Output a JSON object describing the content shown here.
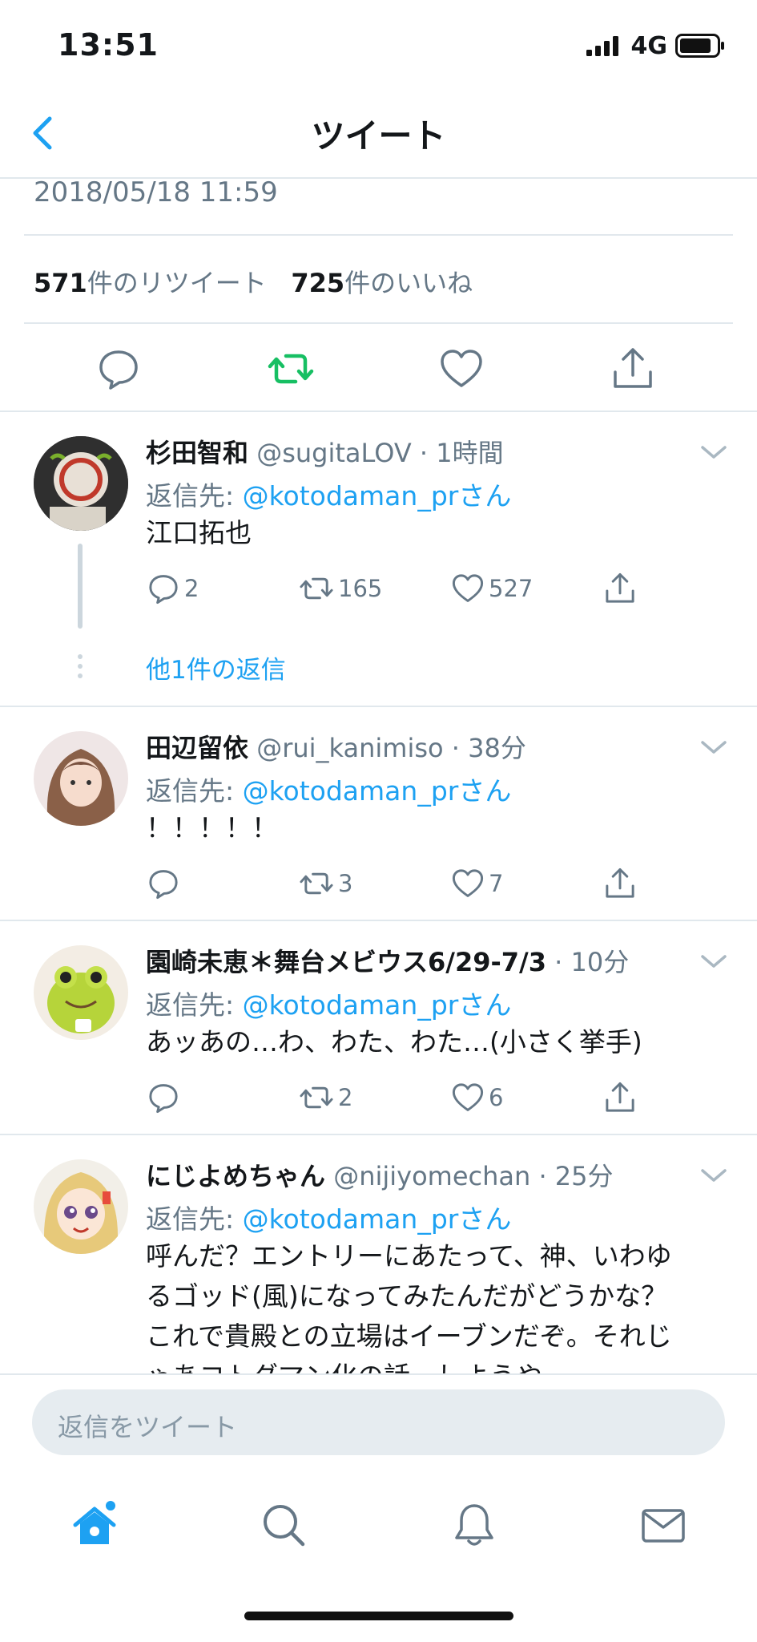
{
  "status_bar": {
    "time": "13:51",
    "network": "4G"
  },
  "nav": {
    "title": "ツイート"
  },
  "tweet": {
    "date": "2018/05/18 11:59",
    "retweet_count": "571",
    "retweet_label": "件のリツイート",
    "like_count": "725",
    "like_label": "件のいいね"
  },
  "replies": [
    {
      "name": "杉田智和",
      "handle_time": "@sugitaLOV · 1時間",
      "reply_prefix": "返信先: ",
      "reply_to": "@kotodaman_prさん",
      "text": "江口拓也",
      "replies": "2",
      "retweets": "165",
      "likes": "527",
      "more": "他1件の返信"
    },
    {
      "name": "田辺留依",
      "handle_time": "@rui_kanimiso · 38分",
      "reply_prefix": "返信先: ",
      "reply_to": "@kotodaman_prさん",
      "text": "！！！！！",
      "replies": "",
      "retweets": "3",
      "likes": "7"
    },
    {
      "name": "園崎未恵＊舞台メビウス6/29-7/3",
      "handle_time": " · 10分",
      "reply_prefix": "返信先: ",
      "reply_to": "@kotodaman_prさん",
      "text": "あッあの…わ、わた、わた…(小さく挙手)",
      "replies": "",
      "retweets": "2",
      "likes": "6"
    },
    {
      "name": "にじよめちゃん",
      "handle_time": "@nijiyomechan · 25分",
      "reply_prefix": "返信先: ",
      "reply_to": "@kotodaman_prさん",
      "text_lines": [
        "呼んだ？エントリーにあたって、神、いわゆ",
        "るゴッド(風)になってみたんだがどうかな？",
        "これで貴殿との立場はイーブンだぞ。それじ",
        "ゃあコトダマン化の話、しようや…"
      ]
    }
  ],
  "composer": {
    "placeholder": "返信をツイート"
  },
  "tab_bar": [
    "home-icon",
    "search-icon",
    "bell-icon",
    "mail-icon"
  ],
  "colors": {
    "accent": "#1da1f2",
    "retweet_green": "#17bf63",
    "muted": "#657786"
  }
}
